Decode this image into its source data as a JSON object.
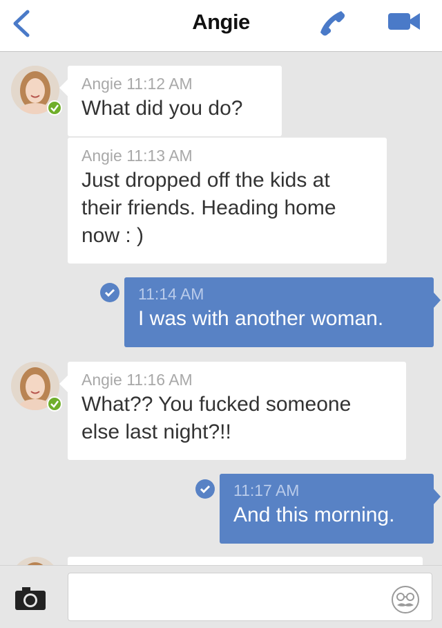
{
  "header": {
    "title": "Angie",
    "back_icon": "chevron-left-icon",
    "call_icon": "phone-icon",
    "video_icon": "video-camera-icon",
    "accent_color": "#4a7ac8"
  },
  "messages": [
    {
      "direction": "incoming",
      "sender": "Angie",
      "time": "11:12 AM",
      "text": "What did you do?"
    },
    {
      "direction": "incoming",
      "sender": "Angie",
      "time": "11:13 AM",
      "text": "Just dropped off the kids at their friends. Heading home now : )"
    },
    {
      "direction": "outgoing",
      "time": "11:14 AM",
      "text": "I was with another woman.",
      "status_icon": "check-circle-icon"
    },
    {
      "direction": "incoming",
      "sender": "Angie",
      "time": "11:16 AM",
      "text": "What?? You fucked someone else last night?!!"
    },
    {
      "direction": "outgoing",
      "time": "11:17 AM",
      "text": "And this morning.",
      "status_icon": "check-circle-icon"
    }
  ],
  "composer": {
    "placeholder": "",
    "camera_icon": "camera-icon",
    "emoji_icon": "mustache-emoji-icon"
  },
  "colors": {
    "outgoing_bubble": "#5882c5",
    "incoming_bubble": "#ffffff",
    "online": "#6fae2a",
    "background": "#e6e6e6"
  }
}
